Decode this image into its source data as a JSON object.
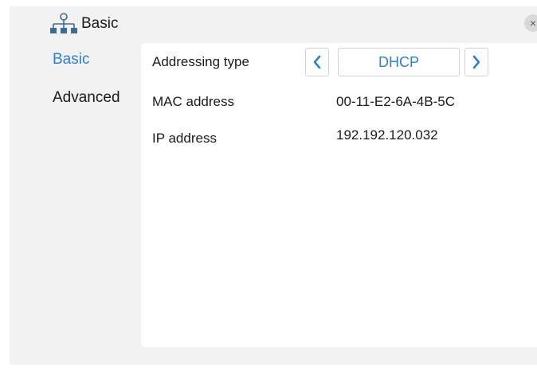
{
  "header": {
    "title": "Basic",
    "close_label": "×"
  },
  "sidebar": {
    "items": [
      {
        "label": "Basic",
        "active": true
      },
      {
        "label": "Advanced",
        "active": false
      }
    ]
  },
  "form": {
    "addressing_type": {
      "label": "Addressing type",
      "value": "DHCP"
    },
    "mac_address": {
      "label": "MAC address",
      "value": "00-11-E2-6A-4B-5C"
    },
    "ip_address": {
      "label": "IP address",
      "value": "192.192.120.032"
    }
  },
  "colors": {
    "accent": "#2b7fd6",
    "window_bg": "#f2f2f2",
    "panel_bg": "#ffffff"
  },
  "icons": {
    "header": "network-icon",
    "prev": "chevron-left-icon",
    "next": "chevron-right-icon"
  }
}
